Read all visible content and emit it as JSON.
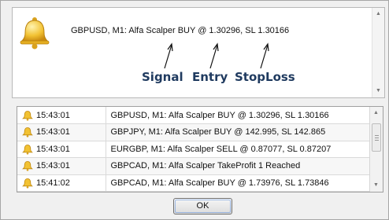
{
  "dialog": {
    "icon": "bell-icon",
    "message": "GBPUSD, M1: Alfa Scalper BUY @ 1.30296,  SL 1.30166",
    "annotations": {
      "signal": "Signal",
      "entry": "Entry",
      "stoploss": "StopLoss"
    }
  },
  "log": {
    "rows": [
      {
        "time": "15:43:01",
        "message": "GBPUSD, M1: Alfa Scalper BUY @ 1.30296,  SL 1.30166"
      },
      {
        "time": "15:43:01",
        "message": "GBPJPY, M1: Alfa Scalper BUY @ 142.995,  SL 142.865"
      },
      {
        "time": "15:43:01",
        "message": "EURGBP, M1: Alfa Scalper SELL @ 0.87077, SL 0.87207"
      },
      {
        "time": "15:43:01",
        "message": "GBPCAD, M1: Alfa Scalper TakeProfit 1 Reached"
      },
      {
        "time": "15:41:02",
        "message": "GBPCAD, M1: Alfa Scalper BUY @ 1.73976,  SL 1.73846"
      }
    ]
  },
  "buttons": {
    "ok": "OK"
  },
  "colors": {
    "annotation": "#1f3a5f",
    "bell": "#f2c233"
  }
}
